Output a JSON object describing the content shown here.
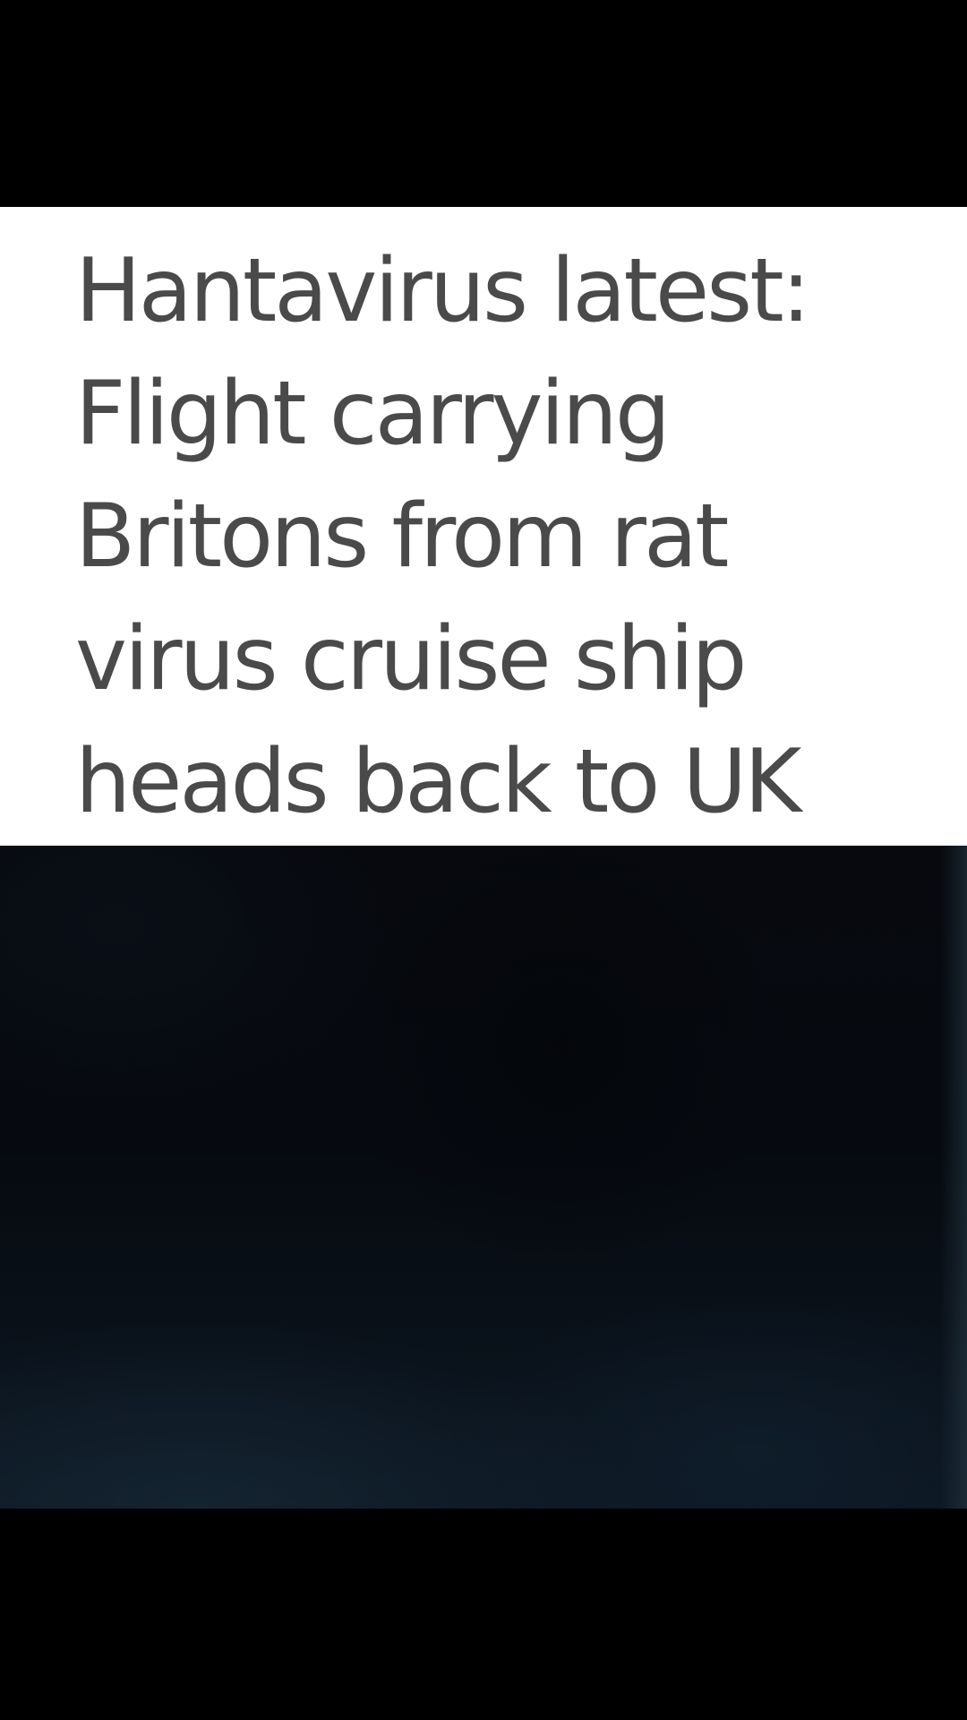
{
  "headline": {
    "text": "Hantavirus latest: Flight carrying Britons from rat virus cruise ship heads back to UK"
  },
  "colors": {
    "letterbox": "#000000",
    "card_background": "#ffffff",
    "headline_text": "#4a4a4a",
    "video_background": "#060a10"
  }
}
